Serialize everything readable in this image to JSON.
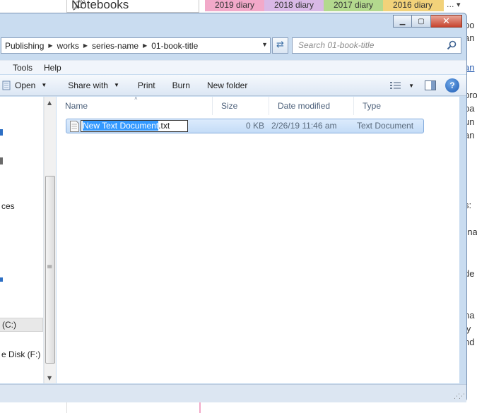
{
  "background": {
    "notebook_box": "Notebooks",
    "tabs": [
      "2019 diary",
      "2018 diary",
      "2017 diary",
      "2016 diary"
    ],
    "more": "...",
    "side_fragments": [
      "po",
      "an",
      "an",
      "pro",
      "ba",
      "un",
      "an",
      "s:",
      "-na",
      "de",
      "na",
      "ly",
      "nd"
    ]
  },
  "window": {
    "address": {
      "crumbs": [
        "Publishing",
        "works",
        "series-name",
        "01-book-title"
      ]
    },
    "search": {
      "placeholder": "Search 01-book-title"
    },
    "menu": [
      "Tools",
      "Help"
    ],
    "commands": {
      "open": "Open",
      "share": "Share with",
      "print": "Print",
      "burn": "Burn",
      "new_folder": "New folder"
    },
    "nav": {
      "items": [
        "ces",
        "(C:)",
        "e Disk (F:)"
      ]
    },
    "columns": [
      "Name",
      "Size",
      "Date modified",
      "Type"
    ],
    "file": {
      "name_selected": "New Text Document",
      "extension": ".txt",
      "size": "0 KB",
      "date": "2/26/19 11:46 am",
      "type": "Text Document"
    }
  },
  "colors": {
    "accent": "#3399ff",
    "row_highlight": "#c4dcf7",
    "tab_pink": "#f2a9c9",
    "tab_green": "#b3d98e",
    "tab_yellow": "#f2d27a"
  }
}
